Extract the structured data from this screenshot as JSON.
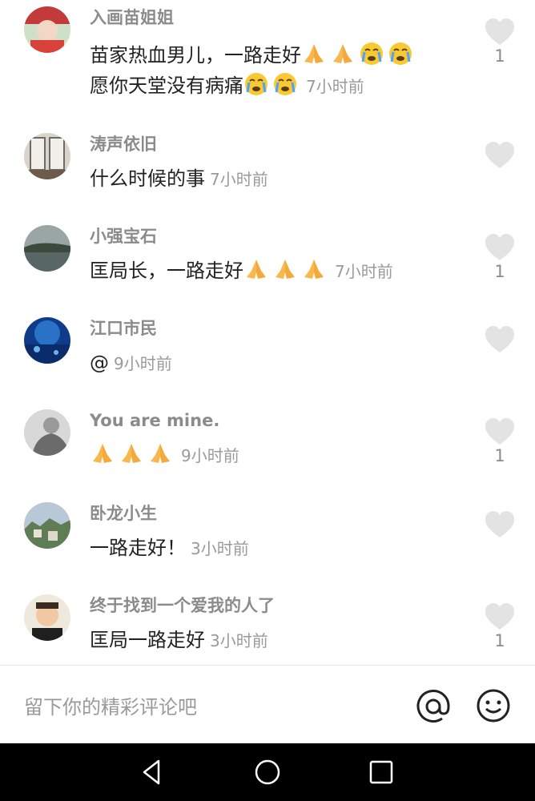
{
  "comments": [
    {
      "user": "入画苗姐姐",
      "text": "苗家热血男儿，一路走好",
      "emojis_after_text": [
        "pray",
        "pray",
        "crying-face",
        "crying-face"
      ],
      "text2": "愿你天堂没有病痛",
      "emojis_after_text2": [
        "crying-face",
        "crying-face"
      ],
      "time": "7小时前",
      "likes": "1",
      "avatar": "avatar-woman-headdress"
    },
    {
      "user": "涛声依旧",
      "text": "什么时候的事",
      "time": "7小时前",
      "likes": "",
      "avatar": "avatar-calligraphy-wall"
    },
    {
      "user": "小强宝石",
      "text": "匡局长，一路走好",
      "emojis_after_text": [
        "pray",
        "pray",
        "pray"
      ],
      "time": "7小时前",
      "likes": "1",
      "avatar": "avatar-lake-landscape"
    },
    {
      "user": "江口市民",
      "text": "@",
      "time": "9小时前",
      "likes": "",
      "avatar": "avatar-blue-ocean"
    },
    {
      "user": "You are mine.",
      "text": "",
      "emojis_before_time": [
        "pray",
        "pray",
        "pray"
      ],
      "time": "9小时前",
      "likes": "1",
      "avatar": "avatar-gray-figure"
    },
    {
      "user": "卧龙小生",
      "text": "一路走好！",
      "time": "3小时前",
      "likes": "",
      "avatar": "avatar-town-view"
    },
    {
      "user": "终于找到一个爱我的人了",
      "text": "匡局一路走好",
      "time": "3小时前",
      "likes": "1",
      "avatar": "avatar-man-portrait"
    }
  ],
  "input": {
    "placeholder": "留下你的精彩评论吧",
    "at_icon": "at-icon",
    "emoji_icon": "smiley-icon"
  },
  "navbar": {
    "back_icon": "back-triangle-icon",
    "home_icon": "home-circle-icon",
    "recents_icon": "recents-square-icon"
  },
  "colors": {
    "username": "#8b8b8b",
    "text": "#222222",
    "time": "#9a9a9a",
    "heart": "#e3e3e3",
    "navbar": "#000000"
  }
}
